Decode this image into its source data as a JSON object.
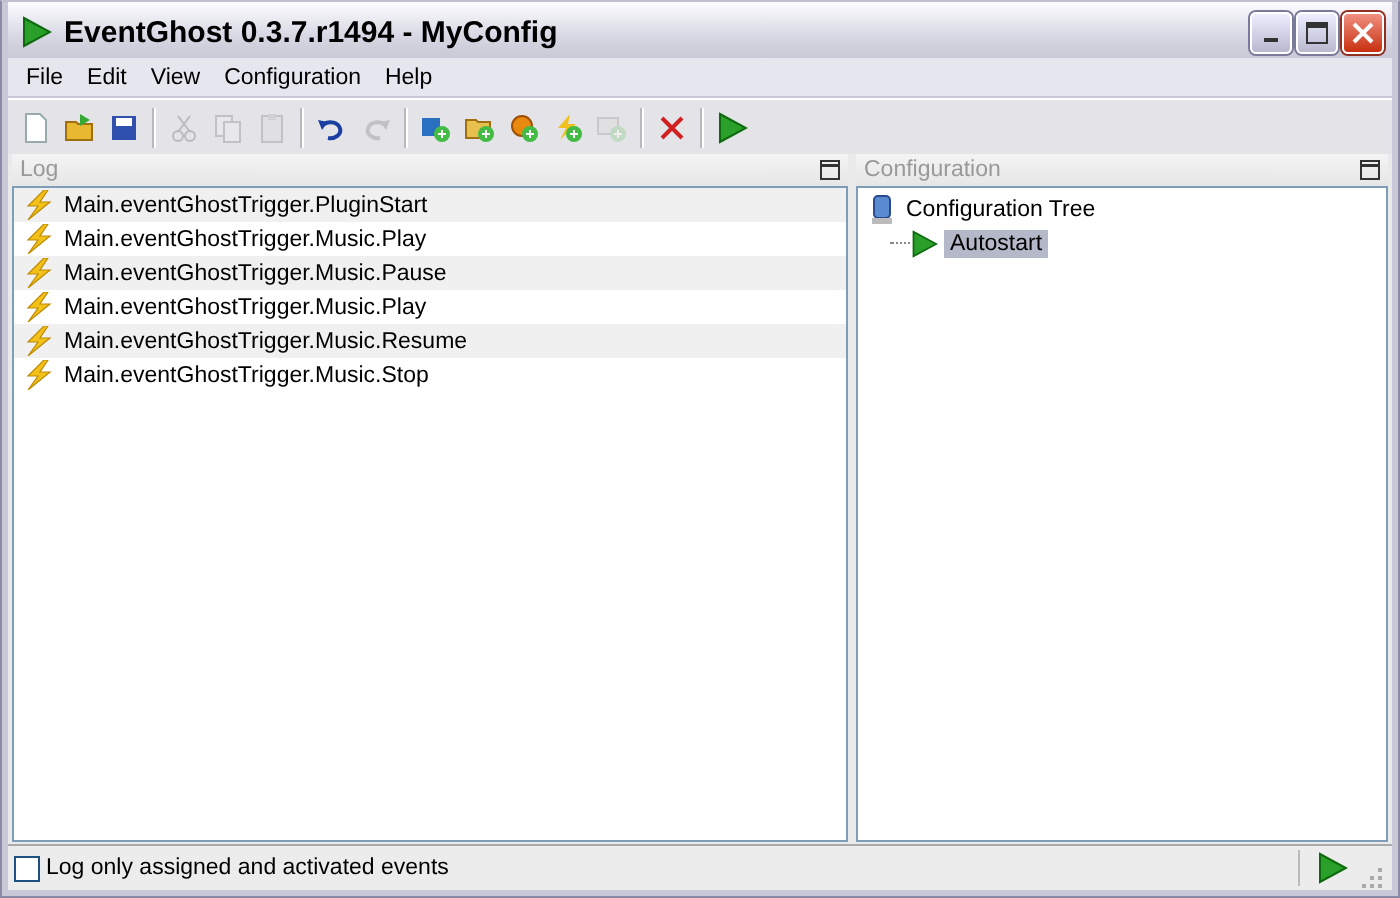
{
  "window": {
    "title": "EventGhost 0.3.7.r1494 - MyConfig"
  },
  "menu": [
    "File",
    "Edit",
    "View",
    "Configuration",
    "Help"
  ],
  "toolbar": [
    {
      "kind": "button",
      "disabled": false
    },
    {
      "kind": "button",
      "disabled": false
    },
    {
      "kind": "button",
      "disabled": false
    },
    {
      "kind": "separator"
    },
    {
      "kind": "button",
      "disabled": true
    },
    {
      "kind": "button",
      "disabled": true
    },
    {
      "kind": "button",
      "disabled": true
    },
    {
      "kind": "separator"
    },
    {
      "kind": "button",
      "disabled": false
    },
    {
      "kind": "button",
      "disabled": true
    },
    {
      "kind": "separator"
    },
    {
      "kind": "button",
      "disabled": false
    },
    {
      "kind": "button",
      "disabled": false
    },
    {
      "kind": "button",
      "disabled": false
    },
    {
      "kind": "button",
      "disabled": false
    },
    {
      "kind": "button",
      "disabled": true
    },
    {
      "kind": "separator"
    },
    {
      "kind": "button",
      "disabled": false
    },
    {
      "kind": "separator"
    },
    {
      "kind": "button",
      "disabled": false
    }
  ],
  "log": {
    "title": "Log",
    "rows": [
      "Main.eventGhostTrigger.PluginStart",
      "Main.eventGhostTrigger.Music.Play",
      "Main.eventGhostTrigger.Music.Pause",
      "Main.eventGhostTrigger.Music.Play",
      "Main.eventGhostTrigger.Music.Resume",
      "Main.eventGhostTrigger.Music.Stop"
    ]
  },
  "configuration": {
    "title": "Configuration",
    "tree": [
      {
        "label": "Configuration Tree",
        "selected": false,
        "children": [
          {
            "label": "Autostart",
            "selected": true
          }
        ]
      }
    ]
  },
  "status_bar": {
    "checkbox": {
      "label": "Log only assigned and activated events",
      "checked": false
    }
  }
}
